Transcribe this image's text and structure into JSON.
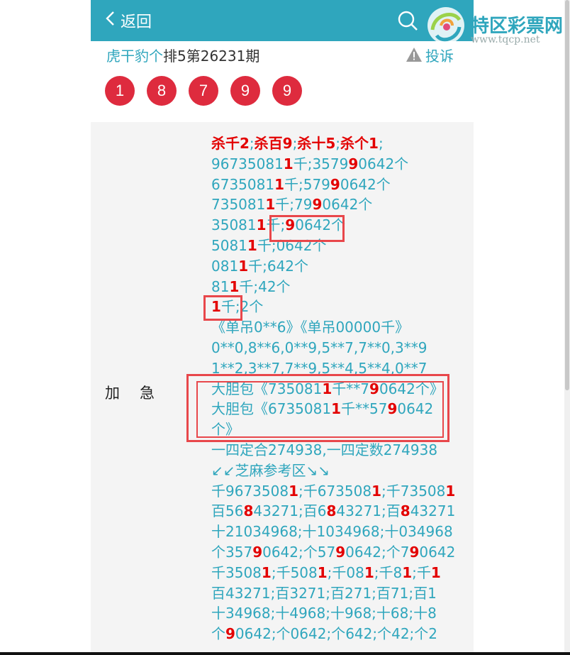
{
  "header": {
    "back_label": "返回"
  },
  "watermark": {
    "site_name": "特区彩票网",
    "site_url": "www.tqcp.net"
  },
  "issue": {
    "lottery_name": "虎干豹个",
    "issue_text": "排5第26231期",
    "complaint_label": "投诉"
  },
  "balls": [
    "1",
    "8",
    "7",
    "9",
    "9"
  ],
  "content": {
    "tag": "加急",
    "line01": [
      "杀千2",
      ";",
      "杀百9",
      ";",
      "杀十5",
      ";",
      "杀个1",
      ";"
    ],
    "line02a": "96735081",
    "line02b": "千;3579",
    "line02c": "0642个",
    "line03a": "6735081",
    "line03b": "千;579",
    "line03c": "0642个",
    "line04a": "735081",
    "line04b": "千;79",
    "line04c": "0642个",
    "line05a": "35081",
    "line05b": "千;",
    "line05c": "9",
    "line05d": "0642个",
    "line06a": "5081",
    "line06b": "千;0642个",
    "line07a": "081",
    "line07b": "千;642个",
    "line08a": "81",
    "line08b": "千;42个",
    "line09a": "1",
    "line09b": "千;2个",
    "line10": "《单吊0**6》《单吊00000千》",
    "line11": "0**0,8**6,0**9,5**7,7**0,3**9",
    "line12": "1**2,3**7,7**9,5**4,5**4,0**7",
    "line13a": "大胆包《735081",
    "line13b": "千**7",
    "line13c": "9",
    "line13d": "0642个》",
    "line14a": "大胆包《6735081",
    "line14b": "千**57",
    "line14c": "9",
    "line14d": "0642 个》",
    "line15": "一四定合274938,一四定数274938",
    "line16": "↙↙芝麻参考区↘↘",
    "line17": [
      "千9673508",
      "1",
      ";千673508",
      "1",
      ";千73508",
      "1"
    ],
    "line18": [
      "百56",
      "8",
      "43271;百6",
      "8",
      "43271;百",
      "8",
      "43271"
    ],
    "line19": "十21034968;十1034968;十034968",
    "line20": [
      "个357",
      "9",
      "0642;个57",
      "9",
      "0642;个7",
      "9",
      "0642"
    ],
    "line21": [
      "千3508",
      "1",
      ";千508",
      "1",
      ";千08",
      "1",
      ";千8",
      "1",
      ";千",
      "1"
    ],
    "line22": "百43271;百3271;百271;百71;百1",
    "line23": "十34968;十4968;十968;十68;十8",
    "line24": [
      "个",
      "9",
      "0642;个0642;个642;个42;个2"
    ]
  },
  "colors": {
    "accent": "#2fa6bd",
    "ball": "#de2b3e",
    "highlight": "#e30000",
    "box": "#e8474b"
  },
  "icons": {
    "back": "chevron-left-icon",
    "search": "search-icon",
    "complaint": "warning-icon",
    "logo": "logo-icon"
  }
}
